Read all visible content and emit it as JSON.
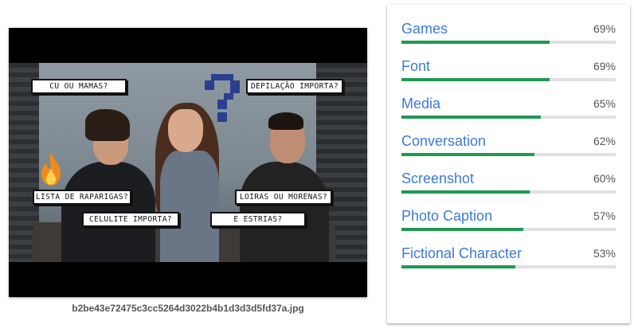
{
  "image": {
    "filename": "b2be43e72475c3cc5264d3022b4b1d3d3d5fd37a.jpg",
    "captions": [
      {
        "id": "cu",
        "text": "CU OU MAMAS?"
      },
      {
        "id": "depil",
        "text": "DEPILAÇÃO IMPORTA?"
      },
      {
        "id": "lista",
        "text": "LISTA DE RAPARIGAS?"
      },
      {
        "id": "loiras",
        "text": "LOIRAS OU MORENAS?"
      },
      {
        "id": "celulite",
        "text": "CELULITE IMPORTA?"
      },
      {
        "id": "estrias",
        "text": "E ESTRIAS?"
      }
    ]
  },
  "labels": [
    {
      "name": "Games",
      "score": "69%",
      "fraction": 0.69
    },
    {
      "name": "Font",
      "score": "69%",
      "fraction": 0.69
    },
    {
      "name": "Media",
      "score": "65%",
      "fraction": 0.65
    },
    {
      "name": "Conversation",
      "score": "62%",
      "fraction": 0.62
    },
    {
      "name": "Screenshot",
      "score": "60%",
      "fraction": 0.6
    },
    {
      "name": "Photo Caption",
      "score": "57%",
      "fraction": 0.57
    },
    {
      "name": "Fictional Character",
      "score": "53%",
      "fraction": 0.53
    }
  ],
  "colors": {
    "label_link": "#3b7bd6",
    "bar_fill": "#1e9a52",
    "bar_track": "#e0e0e0"
  },
  "icons": [
    "question-mark-icon",
    "fire-icon"
  ]
}
